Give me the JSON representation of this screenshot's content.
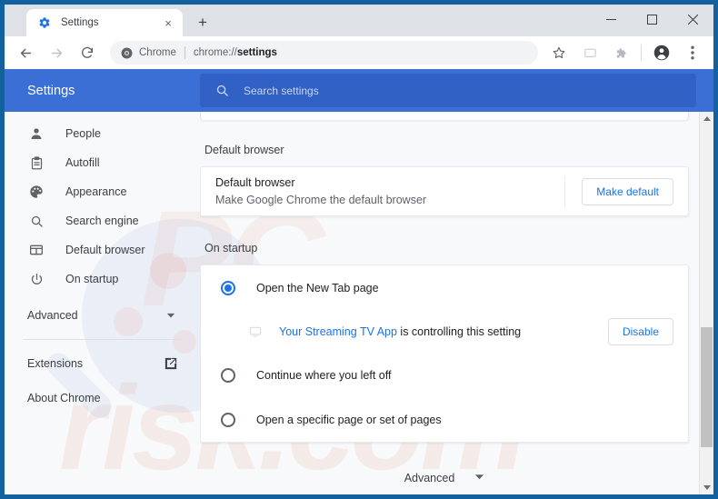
{
  "window": {
    "controls": {
      "minimize": "minimize-icon",
      "maximize": "maximize-icon",
      "close": "close-icon"
    }
  },
  "tabs": [
    {
      "title": "Settings",
      "favicon": "chrome-settings-gear-icon",
      "close_label": "×"
    }
  ],
  "newtab_label": "+",
  "toolbar": {
    "back": "back-arrow-icon",
    "forward": "forward-arrow-icon",
    "reload": "reload-icon",
    "omnibox": {
      "chip_icon": "chrome-logo-icon",
      "chip_text": "Chrome",
      "url_prefix": "chrome://",
      "url_bold": "settings"
    },
    "bookmark": "star-icon",
    "cast": "cast-icon",
    "extensions": "extension-puzzle-icon",
    "profile": "profile-avatar-icon",
    "menu": "three-dot-menu-icon"
  },
  "settings_header": {
    "title": "Settings",
    "search_icon": "search-icon",
    "search_placeholder": "Search settings"
  },
  "sidebar": {
    "items": [
      {
        "label": "People",
        "icon": "person-icon"
      },
      {
        "label": "Autofill",
        "icon": "clipboard-icon"
      },
      {
        "label": "Appearance",
        "icon": "palette-icon"
      },
      {
        "label": "Search engine",
        "icon": "search-icon"
      },
      {
        "label": "Default browser",
        "icon": "browser-window-icon"
      },
      {
        "label": "On startup",
        "icon": "power-icon"
      }
    ],
    "advanced": {
      "label": "Advanced",
      "icon": "chevron-down-icon"
    },
    "footer": [
      {
        "label": "Extensions",
        "icon": "open-in-new-icon"
      },
      {
        "label": "About Chrome",
        "icon": null
      }
    ]
  },
  "main": {
    "default_browser": {
      "section_title": "Default browser",
      "row_title": "Default browser",
      "row_sub": "Make Google Chrome the default browser",
      "button": "Make default"
    },
    "on_startup": {
      "section_title": "On startup",
      "options": [
        {
          "label": "Open the New Tab page",
          "selected": true
        },
        {
          "label": "Continue where you left off",
          "selected": false
        },
        {
          "label": "Open a specific page or set of pages",
          "selected": false
        }
      ],
      "extension_notice": {
        "icon": "extension-controlled-icon",
        "link_text": "Your Streaming TV App",
        "rest_text": " is controlling this setting",
        "button": "Disable"
      }
    },
    "advanced_footer": {
      "label": "Advanced",
      "icon": "chevron-down-icon"
    }
  },
  "scrollbar": {
    "up": "scroll-up-arrow",
    "down": "scroll-down-arrow",
    "thumb": "scroll-thumb"
  },
  "watermark": {
    "top_text": "PC",
    "bottom_text": "risk.com"
  },
  "colors": {
    "frame": "#14619f",
    "header_blue": "#3c6fd6",
    "search_blue": "#3161c4",
    "link_blue": "#1a73e8",
    "body_bg": "#f8f9fa"
  }
}
